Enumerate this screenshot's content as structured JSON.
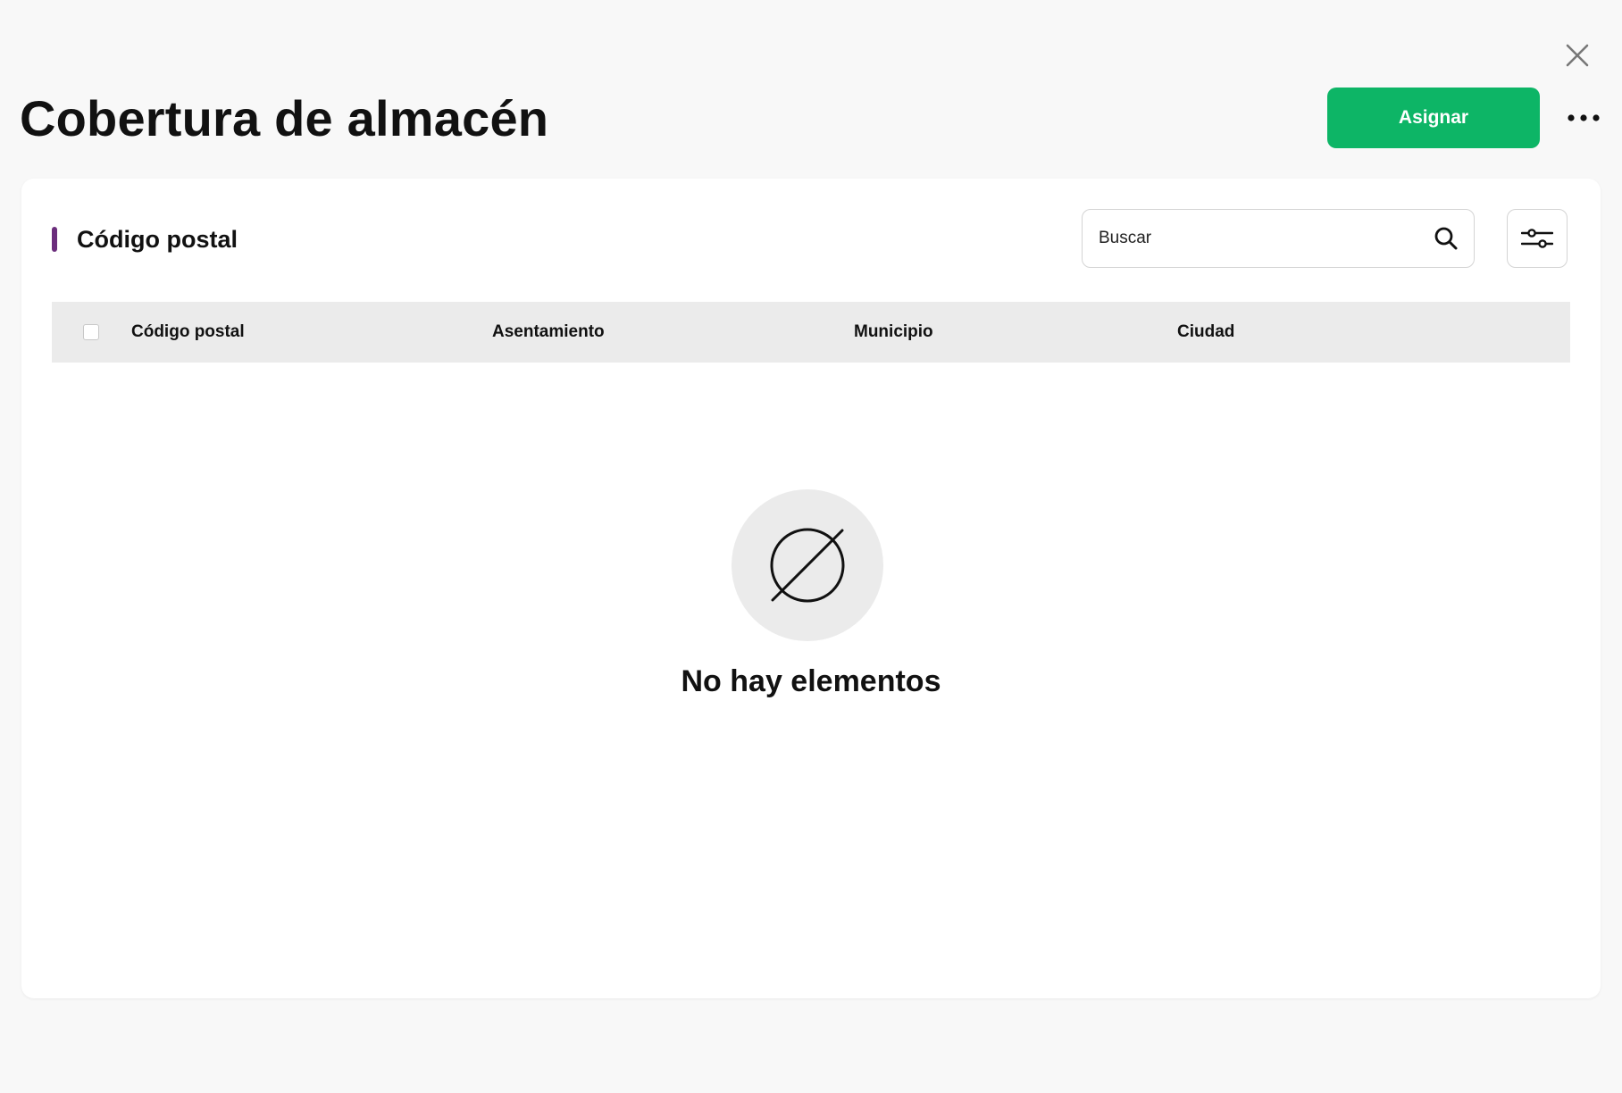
{
  "header": {
    "title": "Cobertura de almacén",
    "assign_label": "Asignar",
    "close_icon": "close-icon",
    "more_icon": "more-horizontal-icon"
  },
  "section": {
    "title": "Código postal",
    "accent_color": "#6b2d7c"
  },
  "search": {
    "placeholder": "Buscar",
    "icon": "search-icon"
  },
  "filter": {
    "icon": "sliders-icon"
  },
  "table": {
    "columns": [
      "Código postal",
      "Asentamiento",
      "Municipio",
      "Ciudad"
    ],
    "rows": []
  },
  "empty_state": {
    "icon": "empty-set-icon",
    "message": "No hay elementos"
  },
  "colors": {
    "primary": "#0db566",
    "accent": "#6b2d7c",
    "background": "#f8f8f8"
  }
}
